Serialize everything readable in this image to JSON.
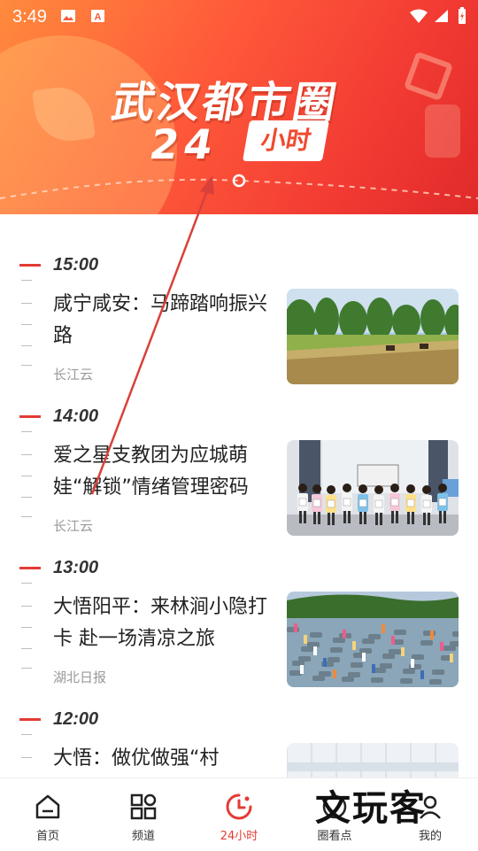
{
  "status_bar": {
    "time": "3:49"
  },
  "banner": {
    "title_line1": "武汉都市圈",
    "title_line2_num": "24",
    "title_line2_tag": "小时"
  },
  "timeline": [
    {
      "hour": "15:00",
      "headline": "咸宁咸安：马蹄踏响振兴路",
      "source": "长江云",
      "image": "horses-on-grass-field"
    },
    {
      "hour": "14:00",
      "headline": "爱之星支教团为应城萌娃“解锁”情绪管理密码",
      "source": "长江云",
      "image": "children-classroom"
    },
    {
      "hour": "13:00",
      "headline": "大悟阳平：来林涧小隐打卡 赴一场清凉之旅",
      "source": "湖北日报",
      "image": "people-in-stream"
    },
    {
      "hour": "12:00",
      "headline": "大悟：做优做强“村",
      "source": "",
      "image": "indoor-hall"
    }
  ],
  "bottom_nav": [
    {
      "label": "首页",
      "icon": "home-icon",
      "active": false
    },
    {
      "label": "频道",
      "icon": "grid-icon",
      "active": false
    },
    {
      "label": "24小时",
      "icon": "clock-icon",
      "active": true
    },
    {
      "label": "圈看点",
      "icon": "discover-icon",
      "active": false
    },
    {
      "label": "我的",
      "icon": "profile-icon",
      "active": false
    }
  ],
  "watermark": "文玩客",
  "colors": {
    "accent": "#e33b33",
    "banner_start": "#ff8a3d",
    "banner_end": "#e02a2a"
  }
}
